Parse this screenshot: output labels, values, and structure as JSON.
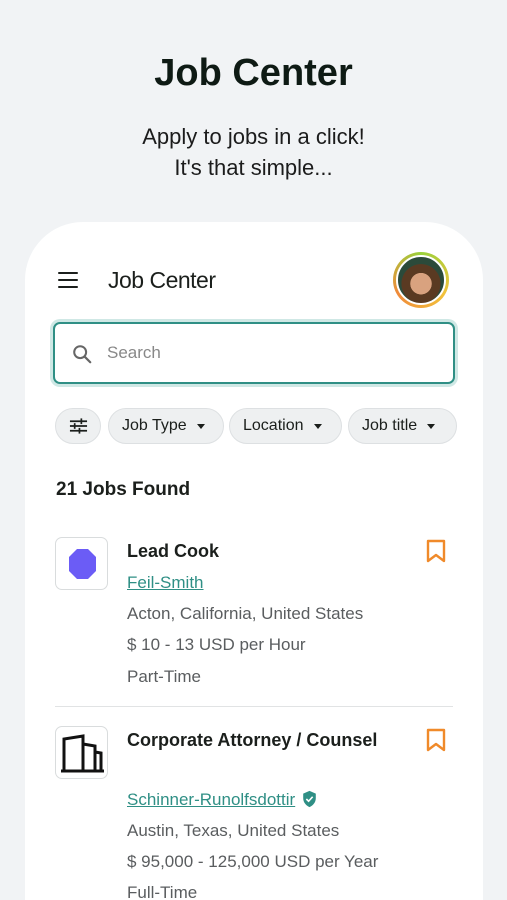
{
  "hero": {
    "title": "Job Center",
    "subtitle_line1": "Apply to jobs in a click!",
    "subtitle_line2": "It's that simple..."
  },
  "appbar": {
    "title": "Job Center",
    "menu_icon": "hamburger-menu-icon",
    "avatar": "user-avatar"
  },
  "search": {
    "placeholder": "Search",
    "value": ""
  },
  "filters": {
    "filter_icon": "sliders-icon",
    "chips": [
      "Job Type",
      "Location",
      "Job title"
    ]
  },
  "results": {
    "count_text": "21 Jobs Found"
  },
  "jobs": [
    {
      "title": "Lead Cook",
      "company": "Feil-Smith",
      "location": "Acton, California, United States",
      "salary": "$ 10 - 13 USD per Hour",
      "type": "Part-Time",
      "logo": "purple-octagon-logo",
      "verified": false
    },
    {
      "title": "Corporate Attorney / Counsel",
      "company": "Schinner-Runolfsdottir",
      "location": "Austin, Texas, United States",
      "salary": "$ 95,000 - 125,000 USD per Year",
      "type": "Full-Time",
      "logo": "building-outline-logo",
      "verified": true
    }
  ],
  "colors": {
    "accent": "#2f8f85",
    "bookmark": "#f08a2a",
    "logo_purple": "#6b5cf6"
  }
}
